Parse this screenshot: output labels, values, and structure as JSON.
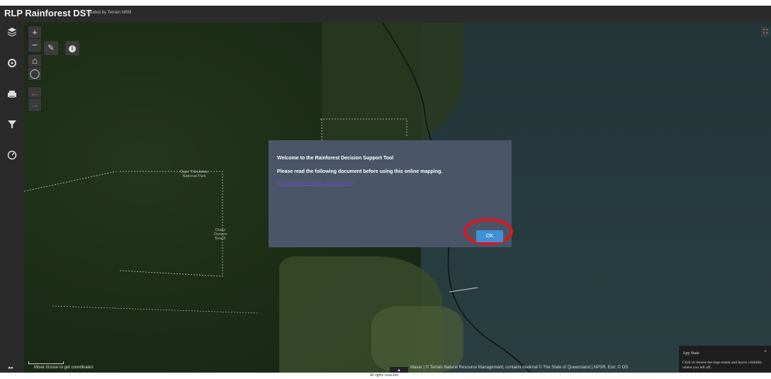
{
  "header": {
    "app_title": "RLP Rainforest DST",
    "app_subtitle": "created by Terrain NRM"
  },
  "left_toolbar": {
    "icons": [
      "layers-icon",
      "basemap-icon",
      "print-icon",
      "filter-icon",
      "dashboard-icon"
    ]
  },
  "map_controls": {
    "zoom_in": "+",
    "zoom_out": "−",
    "home": "⌂",
    "locate": "◯",
    "prev_extent": "←",
    "next_extent": "→",
    "draw": "✎",
    "info": "i",
    "fullscreen": "⛶"
  },
  "map_labels": {
    "park": "Cape Tribulation\nNational Park",
    "beach": "Dianz\nOwners Beach"
  },
  "dialog": {
    "title": "Welcome to the Rainforest Decision Support Tool",
    "body": "Please read the following document before using this online mapping.",
    "link": "RLP Rainforest Planning Tool Document",
    "ok_label": "OK"
  },
  "bottom_bar": {
    "coordinates_text": "Move mouse to get coordinates",
    "attribution": "Maxar | © Terrain Natural Resource Management, contains material © The State of Queensland | NPSR, Esri, © OS",
    "expand_label": "▲",
    "left_toggle": "▸▸"
  },
  "app_state": {
    "title": "App State",
    "body": "Click to restore the map extent and layers visibility where you left off.",
    "close": "×"
  },
  "footer": {
    "text": "All rights reserved"
  },
  "colors": {
    "header_bg": "#2b2b2b",
    "dialog_bg": "#4a5668",
    "ok_button": "#3f90d4",
    "highlight_circle": "#e2141d"
  }
}
